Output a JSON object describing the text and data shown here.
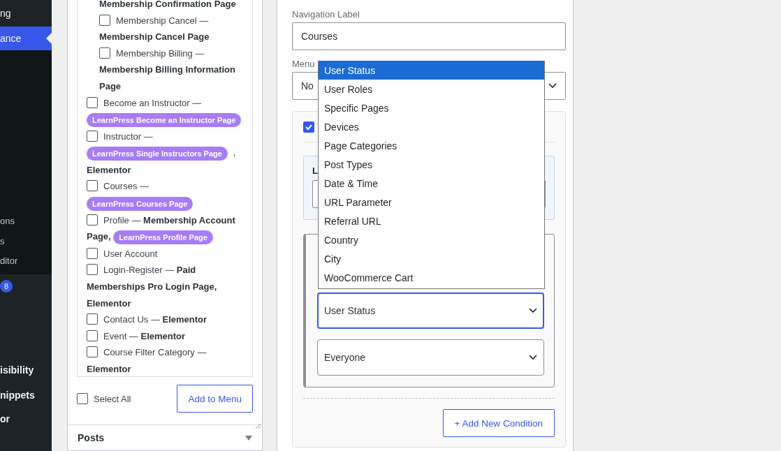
{
  "sidebar": {
    "top_items": [
      {
        "label": "ng",
        "selected": false
      },
      {
        "label": "ance",
        "selected": true
      }
    ],
    "submenu": [
      {
        "label": "ons"
      },
      {
        "label": "s"
      },
      {
        "label": "ditor"
      }
    ],
    "bottom_items": [
      {
        "kind": "badge",
        "badge": "8"
      },
      {
        "kind": "label",
        "label": "isibility"
      },
      {
        "kind": "label",
        "label": "nippets"
      },
      {
        "kind": "label",
        "label": "or"
      }
    ]
  },
  "pages_panel": {
    "items": [
      {
        "kind": "group",
        "children": [
          {
            "kind": "text",
            "segments": [
              {
                "kind": "text",
                "text": "**Membership Confirmation Page**"
              }
            ]
          },
          {
            "kind": "checkbox",
            "checked": false,
            "segments": [
              {
                "kind": "text",
                "text": "Membership Cancel —"
              },
              {
                "kind": "text",
                "text": "**Membership Cancel Page**"
              }
            ]
          },
          {
            "kind": "checkbox",
            "checked": false,
            "segments": [
              {
                "kind": "text",
                "text": "Membership Billing —"
              },
              {
                "kind": "text",
                "text": "**Membership Billing Information**"
              },
              {
                "kind": "text",
                "text": "**Page**"
              }
            ]
          }
        ]
      },
      {
        "kind": "checkbox",
        "checked": false,
        "segments": [
          {
            "kind": "text",
            "text": "Become an Instructor —"
          },
          {
            "kind": "tag",
            "text": "LearnPress Become an Instructor Page"
          }
        ]
      },
      {
        "kind": "checkbox",
        "checked": false,
        "segments": [
          {
            "kind": "text",
            "text": "Instructor —"
          },
          {
            "kind": "tag",
            "text": "LearnPress Single Instructors Page"
          },
          {
            "kind": "text",
            "text": ","
          },
          {
            "kind": "text",
            "text": "**Elementor**"
          }
        ]
      },
      {
        "kind": "checkbox",
        "checked": false,
        "segments": [
          {
            "kind": "text",
            "text": "Courses —"
          },
          {
            "kind": "tag",
            "text": "LearnPress Courses Page"
          }
        ]
      },
      {
        "kind": "checkbox",
        "checked": false,
        "segments": [
          {
            "kind": "text",
            "text": "Profile — **Membership Account**"
          },
          {
            "kind": "text",
            "text": "**Page,**"
          },
          {
            "kind": "tag",
            "text": "LearnPress Profile Page"
          }
        ]
      },
      {
        "kind": "checkbox",
        "checked": false,
        "segments": [
          {
            "kind": "text",
            "text": "User Account"
          }
        ]
      },
      {
        "kind": "checkbox",
        "checked": false,
        "segments": [
          {
            "kind": "text",
            "text": "Login-Register — **Paid**"
          },
          {
            "kind": "text",
            "text": "**Memberships Pro Login Page,**"
          },
          {
            "kind": "text",
            "text": "**Elementor**"
          }
        ]
      },
      {
        "kind": "checkbox",
        "checked": false,
        "segments": [
          {
            "kind": "text",
            "text": "Contact Us — **Elementor**"
          }
        ]
      },
      {
        "kind": "checkbox",
        "checked": false,
        "segments": [
          {
            "kind": "text",
            "text": "Event — **Elementor**"
          }
        ]
      },
      {
        "kind": "checkbox",
        "checked": false,
        "segments": [
          {
            "kind": "text",
            "text": "Course Filter Category —"
          },
          {
            "kind": "text",
            "text": "**Elementor**"
          }
        ]
      }
    ],
    "select_all": {
      "label": "Select All",
      "checked": false
    },
    "add_button": "Add to Menu",
    "next_section": {
      "title": "Posts",
      "expanded": false
    }
  },
  "menu_item": {
    "navigation_label": {
      "label": "Navigation Label",
      "value": "Courses"
    },
    "menu_parent": {
      "label": "Menu",
      "value": "No"
    },
    "visibility": {
      "enabled": true,
      "logic_label": "L",
      "conditions": [
        {
          "value": "User Status",
          "focused": true
        },
        {
          "value": "Everyone",
          "focused": false
        }
      ],
      "add_condition": "+ Add New Condition"
    }
  },
  "dropdown": {
    "options": [
      {
        "label": "User Status",
        "selected": true
      },
      {
        "label": "User Roles",
        "selected": false
      },
      {
        "label": "Specific Pages",
        "selected": false
      },
      {
        "label": "Devices",
        "selected": false
      },
      {
        "label": "Page Categories",
        "selected": false
      },
      {
        "label": "Post Types",
        "selected": false
      },
      {
        "label": "Date & Time",
        "selected": false
      },
      {
        "label": "URL Parameter",
        "selected": false
      },
      {
        "label": "Referral URL",
        "selected": false
      },
      {
        "label": "Country",
        "selected": false
      },
      {
        "label": "City",
        "selected": false
      },
      {
        "label": "WooCommerce Cart",
        "selected": false
      }
    ]
  }
}
